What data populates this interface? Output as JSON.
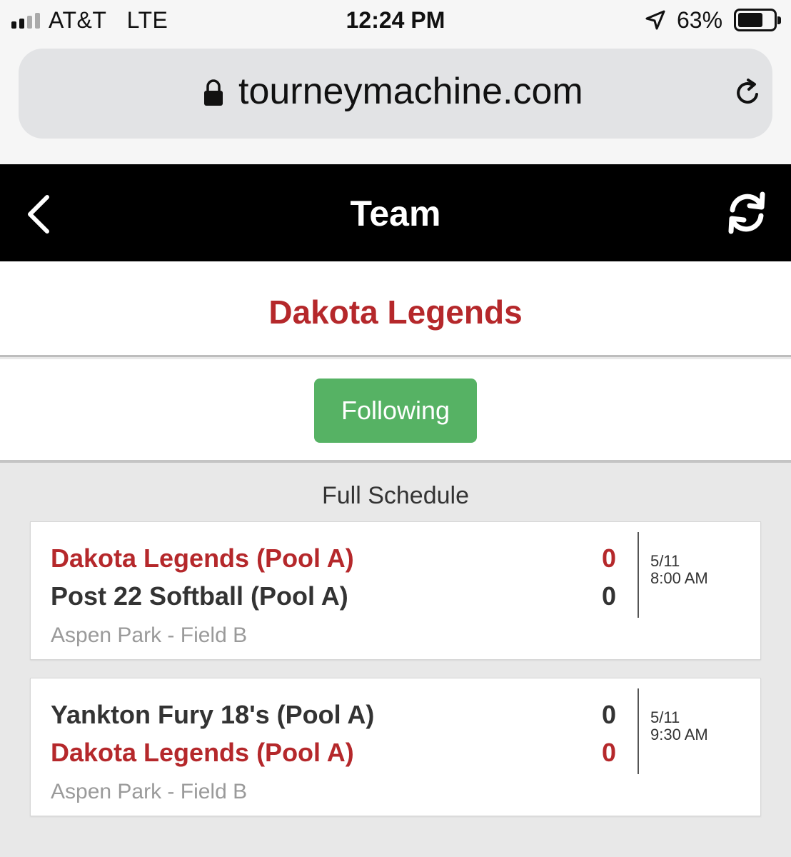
{
  "status_bar": {
    "carrier": "AT&T",
    "network": "LTE",
    "time": "12:24 PM",
    "battery_percent": "63%",
    "battery_level": 0.63,
    "signal_bars_filled": 2,
    "signal_bars_total": 4
  },
  "browser": {
    "url": "tourneymachine.com"
  },
  "header": {
    "title": "Team"
  },
  "team": {
    "name": "Dakota Legends",
    "follow_label": "Following"
  },
  "schedule": {
    "label": "Full Schedule",
    "games": [
      {
        "teams": [
          {
            "name": "Dakota Legends (Pool A)",
            "score": "0",
            "highlight": true
          },
          {
            "name": "Post 22 Softball (Pool A)",
            "score": "0",
            "highlight": false
          }
        ],
        "venue": "Aspen Park - Field B",
        "date": "5/11",
        "time": "8:00 AM"
      },
      {
        "teams": [
          {
            "name": "Yankton Fury 18's (Pool A)",
            "score": "0",
            "highlight": false
          },
          {
            "name": "Dakota Legends (Pool A)",
            "score": "0",
            "highlight": true
          }
        ],
        "venue": "Aspen Park - Field B",
        "date": "5/11",
        "time": "9:30 AM"
      }
    ]
  },
  "colors": {
    "accent_red": "#b5282b",
    "follow_green": "#56b264",
    "header_black": "#000000"
  },
  "icons": [
    "lock-icon",
    "reload-icon",
    "back-icon",
    "refresh-icon",
    "location-arrow-icon",
    "battery-icon",
    "signal-icon"
  ]
}
